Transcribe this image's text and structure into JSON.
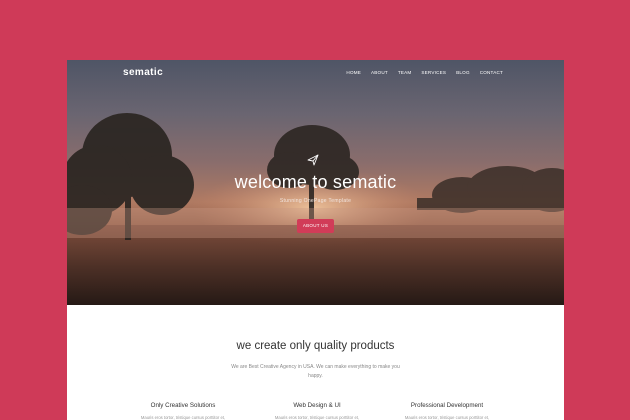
{
  "colors": {
    "background": "#cf3a58",
    "accent": "#d13c58"
  },
  "header": {
    "brand": "sematic",
    "nav": [
      "HOME",
      "ABOUT",
      "TEAM",
      "SERVICES",
      "BLOG",
      "CONTACT"
    ]
  },
  "hero": {
    "icon": "paper-plane-icon",
    "title": "welcome to sematic",
    "subtitle": "Stunning OnePage Template",
    "button": "ABOUT US"
  },
  "section": {
    "title": "we create only quality products",
    "description": "We are Best Creative Agency in USA. We can make everything to make you happy."
  },
  "features": [
    {
      "title": "Only Creative Solutions",
      "text": "Mauris eros tortor, tristique cursus porttitor et,"
    },
    {
      "title": "Web Design & UI",
      "text": "Mauris eros tortor, tristique cursus porttitor et,"
    },
    {
      "title": "Professional Development",
      "text": "Mauris eros tortor, tristique cursus porttitor et,"
    }
  ]
}
